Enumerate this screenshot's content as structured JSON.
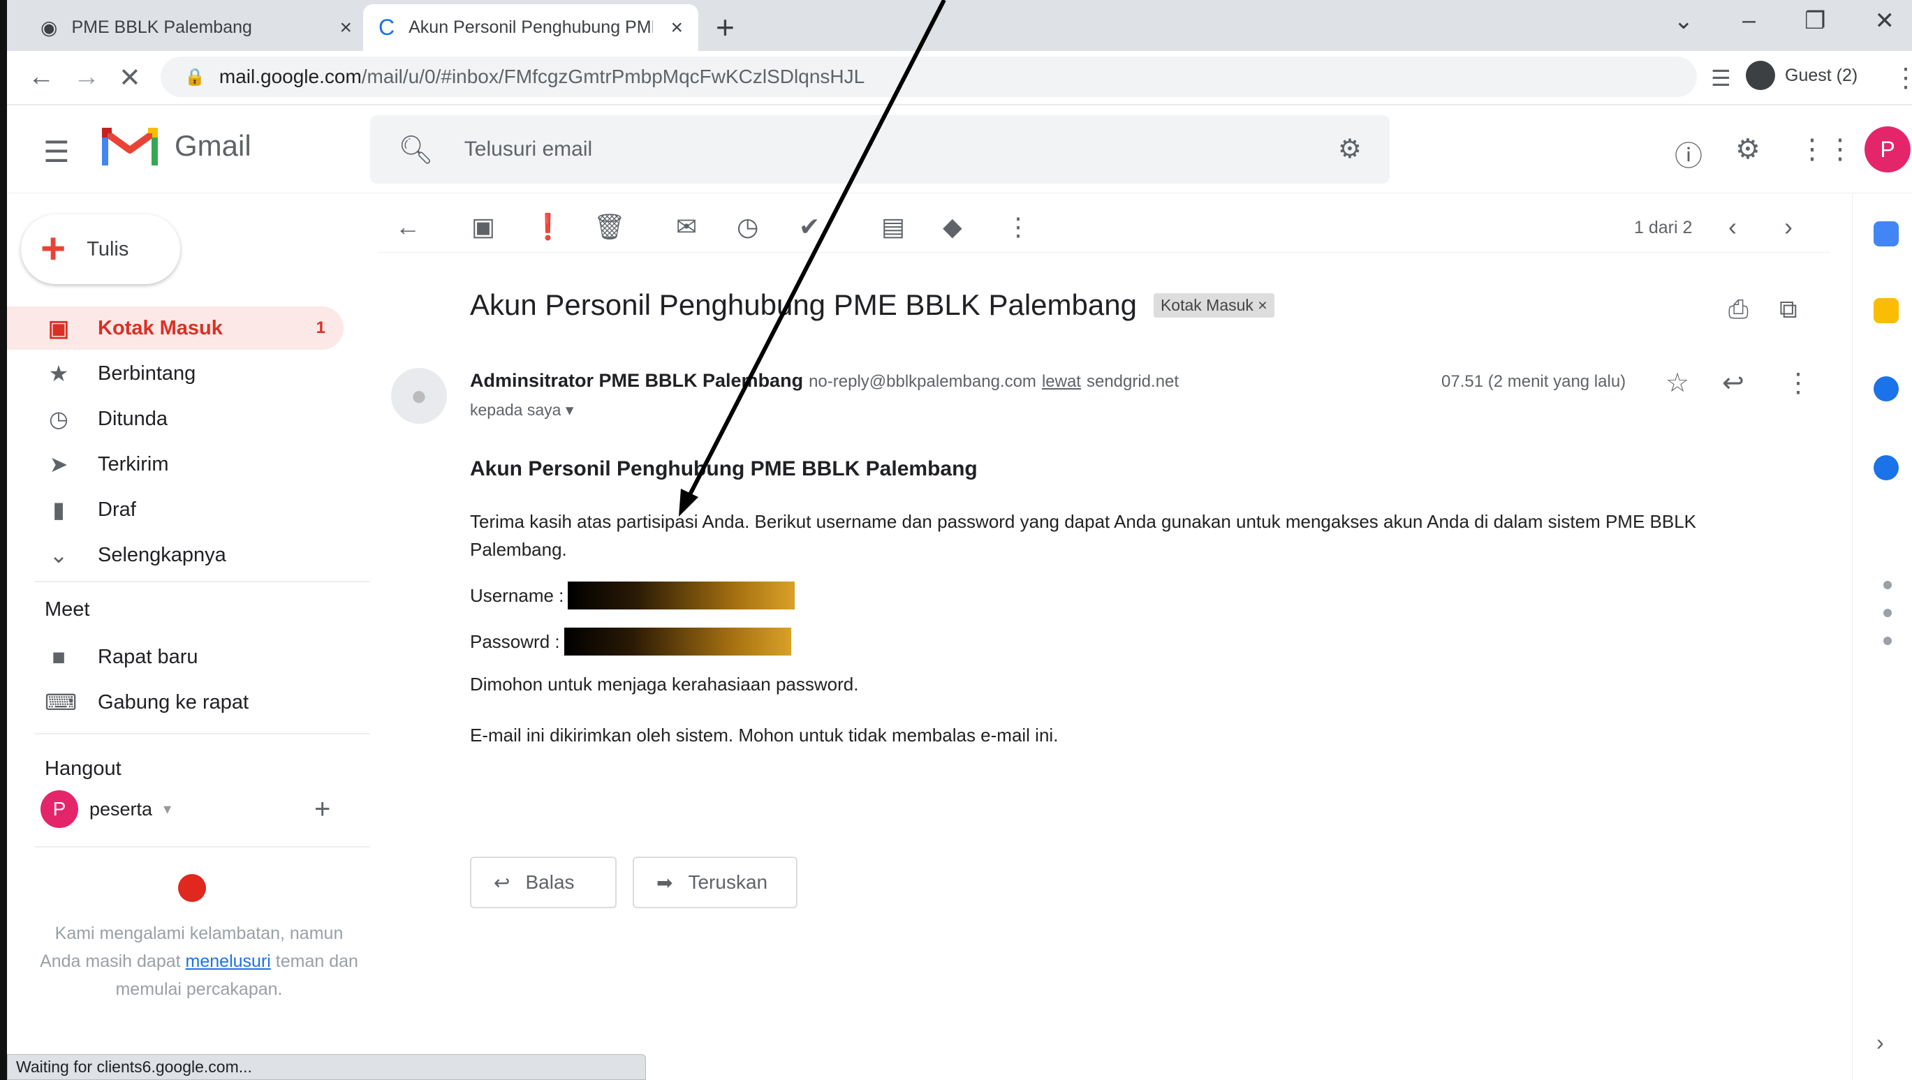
{
  "browser": {
    "tabs": [
      {
        "title": "PME BBLK Palembang",
        "close": "×"
      },
      {
        "title": "Akun Personil Penghubung PME",
        "close": "×"
      }
    ],
    "new_tab": "+",
    "url_host": "mail.google.com",
    "url_path": "/mail/u/0/#inbox/FMfcgzGmtrPmbpMqcFwKCzlSDlqnsHJL",
    "profile_label": "Guest (2)",
    "status_text": "Waiting for clients6.google.com..."
  },
  "gmail": {
    "logo_text": "Gmail",
    "search_placeholder": "Telusuri email",
    "avatar_letter": "P"
  },
  "sidebar": {
    "compose_label": "Tulis",
    "items": [
      {
        "label": "Kotak Masuk",
        "count": "1",
        "icon": "inbox-icon"
      },
      {
        "label": "Berbintang",
        "icon": "star-icon"
      },
      {
        "label": "Ditunda",
        "icon": "clock-icon"
      },
      {
        "label": "Terkirim",
        "icon": "send-icon"
      },
      {
        "label": "Draf",
        "icon": "file-icon"
      },
      {
        "label": "Selengkapnya",
        "icon": "chevron-down-icon"
      }
    ],
    "meet_title": "Meet",
    "meet_items": [
      {
        "label": "Rapat baru",
        "icon": "video-icon"
      },
      {
        "label": "Gabung ke rapat",
        "icon": "keyboard-icon"
      }
    ],
    "hangout_title": "Hangout",
    "hangout_user": "peserta",
    "hangout_user_letter": "P",
    "slow_msg_a": "Kami mengalami kelambatan, namun Anda masih dapat ",
    "slow_msg_link": "menelusuri",
    "slow_msg_b": " teman dan memulai percakapan."
  },
  "toolbar": {
    "pager": "1 dari 2"
  },
  "message": {
    "subject": "Akun Personil Penghubung PME BBLK Palembang",
    "label_chip": "Kotak Masuk ×",
    "sender_name": "Adminsitrator PME BBLK Palembang",
    "sender_email": "no-reply@bblkpalembang.com",
    "via_word": "lewat",
    "via_host": "sendgrid.net",
    "recipient": "kepada saya ▾",
    "time": "07.51 (2 menit yang lalu)",
    "body_title": "Akun Personil Penghubung PME BBLK Palembang",
    "body_intro": "Terima kasih atas partisipasi Anda. Berikut username dan password yang dapat Anda gunakan untuk mengakses akun Anda di dalam sistem PME BBLK Palembang.",
    "username_label": "Username :",
    "password_label": "Passowrd :",
    "note": "Dimohon untuk menjaga kerahasiaan password.",
    "footer": "E-mail ini dikirimkan oleh sistem. Mohon untuk tidak membalas e-mail ini.",
    "reply_label": "Balas",
    "forward_label": "Teruskan"
  },
  "colors": {
    "accent_red": "#d93025",
    "active_bg": "#fce8e6",
    "avatar_pink": "#e52569"
  }
}
